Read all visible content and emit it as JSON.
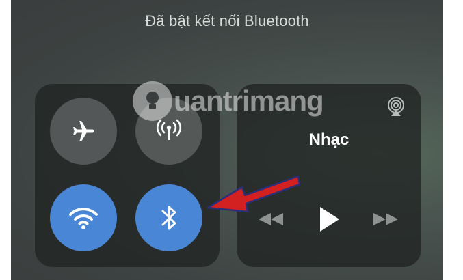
{
  "status": {
    "text": "Đã bật kết nối Bluetooth"
  },
  "connectivity": {
    "airplane": {
      "icon": "airplane-icon",
      "state": "off"
    },
    "cellular": {
      "icon": "antenna-icon",
      "state": "off"
    },
    "wifi": {
      "icon": "wifi-icon",
      "state": "on"
    },
    "bluetooth": {
      "icon": "bluetooth-icon",
      "state": "on"
    }
  },
  "music": {
    "title": "Nhạc",
    "airplay_icon": "airplay-icon",
    "controls": [
      "rewind-icon",
      "play-icon",
      "fast-forward-icon"
    ]
  },
  "watermark": {
    "text": "uantrimang",
    "logo": "lightbulb-q-icon"
  },
  "annotation": {
    "icon": "red-arrow-icon",
    "color": "#d32020"
  },
  "colors": {
    "toggle_on": "#4a86d6",
    "toggle_off": "#7c8080",
    "panel": "#202423"
  }
}
